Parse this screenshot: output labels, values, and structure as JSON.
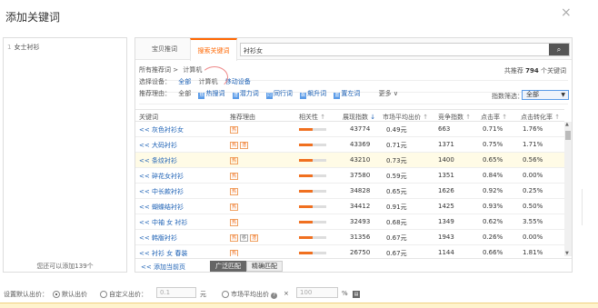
{
  "dialog": {
    "title": "添加关键词",
    "close_icon": "×"
  },
  "sidebar": {
    "items": [
      {
        "index": "1",
        "label": "女士衬衫"
      }
    ],
    "footer": "您还可以添加139个"
  },
  "tabs": [
    {
      "label": "宝贝推词",
      "active": false
    },
    {
      "label": "搜索关键词",
      "active": true
    }
  ],
  "search": {
    "value": "衬衫女",
    "button_icon": "search-icon"
  },
  "breadcrumb": {
    "root": "所有推荐词 >",
    "current": "计算机"
  },
  "total": {
    "prefix": "共推荐",
    "count": "794",
    "suffix": "个关键词"
  },
  "device": {
    "label": "选择设备：",
    "options": [
      "全部",
      "计算机",
      "移动设备"
    ]
  },
  "reason": {
    "label": "推荐理由：",
    "options": [
      "全部",
      "热搜词",
      "潜力词",
      "同行词",
      "飙升词",
      "置左词"
    ],
    "more": "更多"
  },
  "index_filter": {
    "label": "指数筛选：",
    "selected": "全部"
  },
  "columns": [
    "关键词",
    "推荐理由",
    "相关性",
    "展现指数",
    "市场平均出价",
    "竞争指数",
    "点击率",
    "点击转化率"
  ],
  "rows": [
    {
      "prefix": "<<",
      "keyword": "灰色衬衫女",
      "tags": [
        "热"
      ],
      "relevance": 0.5,
      "impressions": "43774",
      "avg_bid": "0.49元",
      "competition": "663",
      "ctr": "0.71%",
      "cvr": "1.76%",
      "highlight": false
    },
    {
      "prefix": "<<",
      "keyword": "大码衬衫",
      "tags": [
        "热",
        "潜"
      ],
      "relevance": 0.5,
      "impressions": "43369",
      "avg_bid": "0.71元",
      "competition": "1371",
      "ctr": "0.75%",
      "cvr": "1.71%",
      "highlight": false
    },
    {
      "prefix": "<<",
      "keyword": "条纹衬衫",
      "tags": [
        "热"
      ],
      "relevance": 0.5,
      "impressions": "43210",
      "avg_bid": "0.73元",
      "competition": "1400",
      "ctr": "0.65%",
      "cvr": "0.56%",
      "highlight": true
    },
    {
      "prefix": "<<",
      "keyword": "碎花女衬衫",
      "tags": [
        "热"
      ],
      "relevance": 0.5,
      "impressions": "37580",
      "avg_bid": "0.59元",
      "competition": "1351",
      "ctr": "0.84%",
      "cvr": "0.00%",
      "highlight": false
    },
    {
      "prefix": "<<",
      "keyword": "中长款衬衫",
      "tags": [
        "热"
      ],
      "relevance": 0.5,
      "impressions": "34828",
      "avg_bid": "0.65元",
      "competition": "1626",
      "ctr": "0.92%",
      "cvr": "0.25%",
      "highlight": false
    },
    {
      "prefix": "<<",
      "keyword": "蝴蝶结衬衫",
      "tags": [
        "热"
      ],
      "relevance": 0.5,
      "impressions": "34412",
      "avg_bid": "0.91元",
      "competition": "1425",
      "ctr": "0.93%",
      "cvr": "0.50%",
      "highlight": false
    },
    {
      "prefix": "<<",
      "keyword": "中袖 女 衬衫",
      "tags": [
        "热"
      ],
      "relevance": 0.5,
      "impressions": "32493",
      "avg_bid": "0.68元",
      "competition": "1349",
      "ctr": "0.62%",
      "cvr": "3.55%",
      "highlight": false
    },
    {
      "prefix": "<<",
      "keyword": "韩版衬衫",
      "tags": [
        "热",
        "移",
        "潜"
      ],
      "relevance": 0.5,
      "impressions": "31356",
      "avg_bid": "0.67元",
      "competition": "1943",
      "ctr": "0.26%",
      "cvr": "0.00%",
      "highlight": false
    },
    {
      "prefix": "<<",
      "keyword": "衬衫 女 春装",
      "tags": [
        "热"
      ],
      "relevance": 0.5,
      "impressions": "26750",
      "avg_bid": "0.67元",
      "competition": "1144",
      "ctr": "0.66%",
      "cvr": "1.81%",
      "highlight": false
    }
  ],
  "table_footer": {
    "add_label": "<<  添加当前页",
    "broad_match": "广泛匹配",
    "exact_match": "精确匹配"
  },
  "bid": {
    "label": "设置默认出价：",
    "default_label": "默认出价",
    "custom_label": "自定义出价：",
    "custom_placeholder": "0.1",
    "unit": "元",
    "market_label": "市场平均出价",
    "times": "×",
    "percent_placeholder": "100",
    "percent_unit": "%"
  },
  "colors": {
    "accent": "#ff6600",
    "link": "#1a5fb4"
  }
}
